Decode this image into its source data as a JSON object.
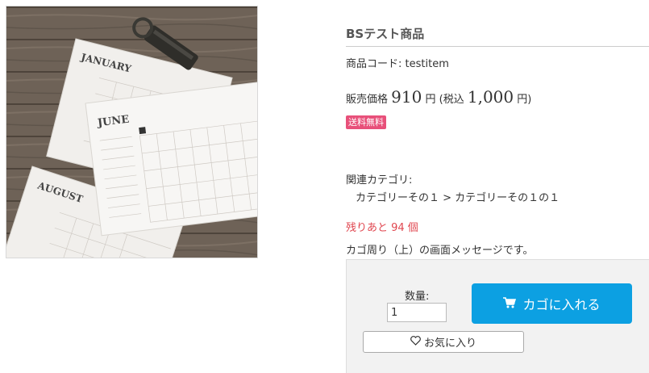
{
  "product": {
    "title": "BSテスト商品",
    "code_label": "商品コード:",
    "code_value": "testitem",
    "price_label": "販売価格",
    "price_value": "910",
    "price_unit": "円",
    "tax_label": "(税込",
    "tax_value": "1,000",
    "tax_unit": "円)",
    "free_shipping": "送料無料",
    "related_label": "関連カテゴリ:",
    "related_path": "カテゴリーその１ > カテゴリーその１の１",
    "stock_text": "残りあと 94 個",
    "cart_message": "カゴ周り（上）の画面メッセージです。"
  },
  "image": {
    "calendars": [
      "JANUARY",
      "JUNE",
      "AUGUST"
    ]
  },
  "cart": {
    "qty_label": "数量:",
    "qty_value": "1",
    "add_label": "カゴに入れる",
    "fav_label": "お気に入り"
  },
  "colors": {
    "accent_blue": "#0ca0e2",
    "badge_pink": "#e8507a",
    "stock_red": "#e0464f"
  }
}
